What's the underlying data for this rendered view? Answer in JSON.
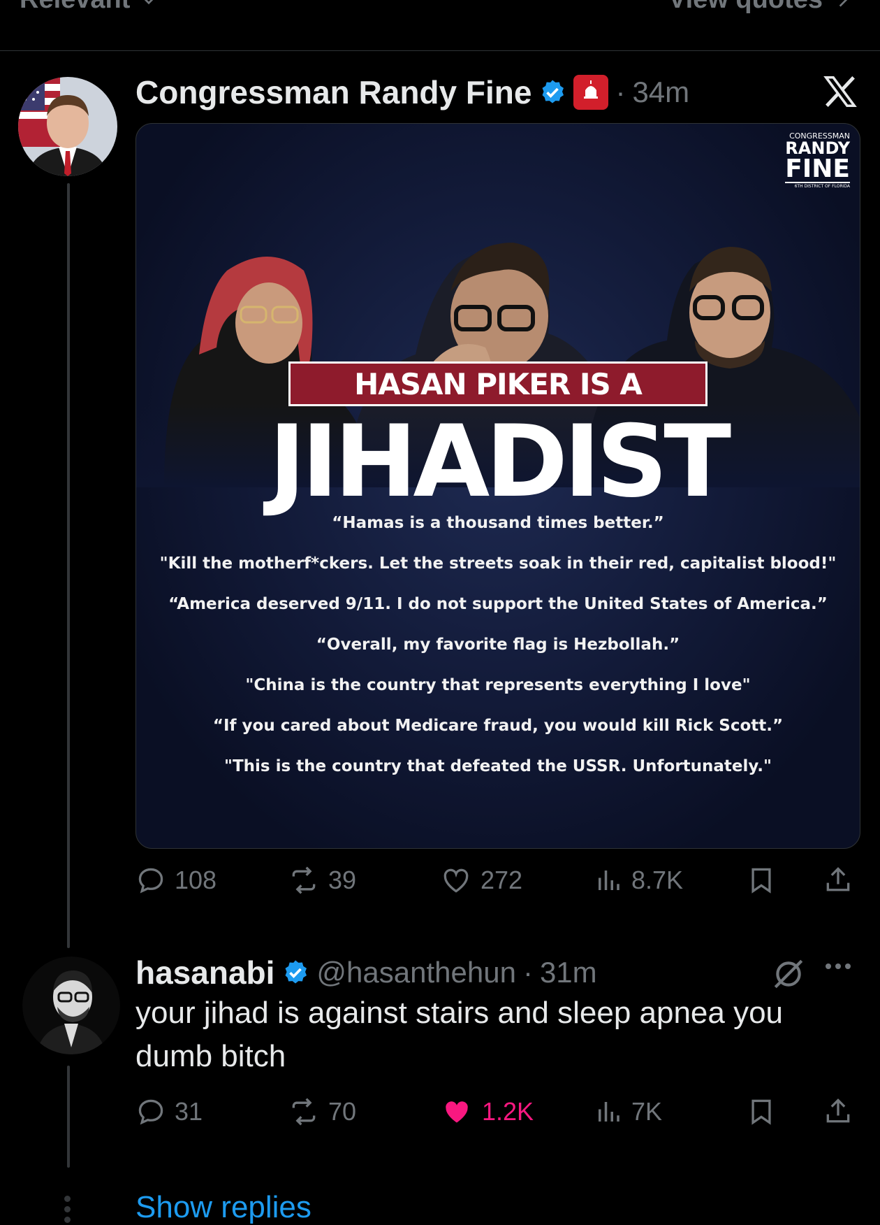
{
  "header": {
    "sort_label": "Relevant",
    "view_quotes_label": "View quotes"
  },
  "post": {
    "author_name": "Congressman Randy Fine",
    "time": "34m",
    "separator": "·",
    "platform_logo": "x-logo-icon",
    "media": {
      "logo_top": "CONGRESSMAN",
      "logo_main_1": "RANDY",
      "logo_main_2": "FINE",
      "logo_bottom": "6TH DISTRICT OF FLORIDA",
      "headline_small": "HASAN PIKER IS A",
      "headline_big": "JIHADIST",
      "quotes": [
        "“Hamas is a thousand times better.”",
        "\"Kill the motherf*ckers. Let the streets soak in their red, capitalist blood!\"",
        "“America deserved 9/11. I do not support the United States of America.”",
        "“Overall, my favorite flag is Hezbollah.”",
        "\"China is the country that represents everything I love\"",
        "“If you cared about Medicare fraud, you would kill Rick Scott.”",
        "\"This is the country that defeated the USSR. Unfortunately.\""
      ]
    },
    "stats": {
      "replies": "108",
      "reposts": "39",
      "likes": "272",
      "views": "8.7K"
    }
  },
  "reply": {
    "author_name": "hasanabi",
    "handle": "@hasanthehun",
    "separator": "·",
    "time": "31m",
    "text": "your jihad is against stairs and sleep apnea you dumb bitch",
    "stats": {
      "replies": "31",
      "reposts": "70",
      "likes": "1.2K",
      "views": "7K"
    }
  },
  "show_replies_label": "Show replies",
  "colors": {
    "accent": "#1d9bf0",
    "like_active": "#f91880",
    "verified": "#1d9bf0",
    "muted": "#71767b"
  }
}
